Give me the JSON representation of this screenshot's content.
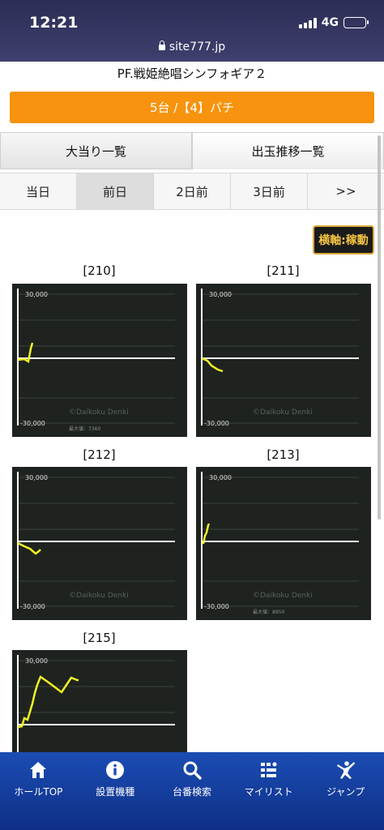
{
  "status_bar": {
    "time": "12:21",
    "network": "4G",
    "url": "site777.jp"
  },
  "page": {
    "title": "PF.戦姫絶唱シンフォギア２",
    "summary": "5台 /【4】パチ"
  },
  "tabs": [
    {
      "label": "大当り一覧",
      "active": false
    },
    {
      "label": "出玉推移一覧",
      "active": true
    }
  ],
  "day_tabs": [
    {
      "label": "当日",
      "selected": false
    },
    {
      "label": "前日",
      "selected": true
    },
    {
      "label": "2日前",
      "selected": false
    },
    {
      "label": "3日前",
      "selected": false
    },
    {
      "label": ">>",
      "selected": false
    }
  ],
  "axis_button": "横軸:稼動",
  "graphs": [
    {
      "machine": "[210]",
      "y_max_label": "30,000",
      "y_min_label": "-30,000",
      "watermark": "©Daikoku Denki",
      "max_note": "最大値：7360"
    },
    {
      "machine": "[211]",
      "y_max_label": "30,000",
      "y_min_label": "-30,000",
      "watermark": "©Daikoku Denki",
      "max_note": ""
    },
    {
      "machine": "[212]",
      "y_max_label": "30,000",
      "y_min_label": "-30,000",
      "watermark": "©Daikoku Denki",
      "max_note": ""
    },
    {
      "machine": "[213]",
      "y_max_label": "30,000",
      "y_min_label": "-30,000",
      "watermark": "©Daikoku Denki",
      "max_note": "最大値：8950"
    },
    {
      "machine": "[215]",
      "y_max_label": "30,000",
      "y_min_label": "",
      "watermark": "",
      "max_note": ""
    }
  ],
  "bottom_nav": [
    {
      "label": "ホールTOP",
      "icon": "home-icon"
    },
    {
      "label": "設置機種",
      "icon": "info-icon"
    },
    {
      "label": "台番検索",
      "icon": "search-icon"
    },
    {
      "label": "マイリスト",
      "icon": "list-icon"
    },
    {
      "label": "ジャンプ",
      "icon": "jump-icon"
    }
  ],
  "colors": {
    "accent_orange": "#f7930e",
    "nav_blue": "#1b4db4",
    "graph_line": "#f1f224",
    "graph_bg": "#1e2320",
    "axis_button_text": "#f5c542"
  }
}
